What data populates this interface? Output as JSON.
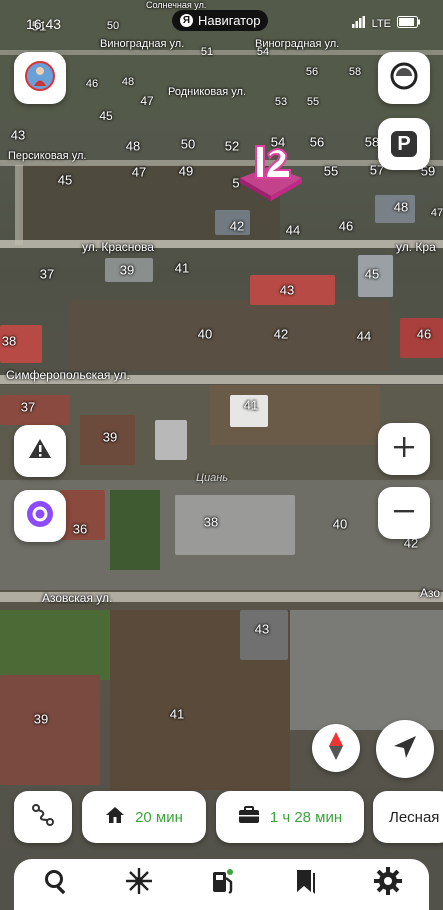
{
  "status_bar": {
    "time": "16:43",
    "app_name": "Навигатор",
    "network": "LTE"
  },
  "map": {
    "streets": {
      "top_street": "Солнечная ул.",
      "vinogradnaya_left": "Виноградная ул.",
      "vinogradnaya_right": "Виноградная ул.",
      "rodnikovaya": "Родниковая ул.",
      "persikovaya": "Персиковая ул.",
      "krasnova_left": "ул. Краснова",
      "krasnova_right": "ул. Кра",
      "simferopolskaya": "Симферопольская ул.",
      "azovskaya_left": "Азовская ул.",
      "azovskaya_right": "Азо"
    },
    "house_numbers": [
      {
        "label": "51"
      },
      {
        "label": "50"
      },
      {
        "label": "49"
      },
      {
        "label": "48"
      },
      {
        "label": "51"
      },
      {
        "label": "54"
      },
      {
        "label": "56"
      },
      {
        "label": "58"
      },
      {
        "label": "46"
      },
      {
        "label": "48"
      },
      {
        "label": "47"
      },
      {
        "label": "53"
      },
      {
        "label": "55"
      },
      {
        "label": "45"
      },
      {
        "label": "48"
      },
      {
        "label": "50"
      },
      {
        "label": "52"
      },
      {
        "label": "54"
      },
      {
        "label": "56"
      },
      {
        "label": "58"
      },
      {
        "label": "43"
      },
      {
        "label": "45"
      },
      {
        "label": "47"
      },
      {
        "label": "49"
      },
      {
        "label": "5"
      },
      {
        "label": "55"
      },
      {
        "label": "57"
      },
      {
        "label": "59"
      },
      {
        "label": "48"
      },
      {
        "label": "42"
      },
      {
        "label": "44"
      },
      {
        "label": "46"
      },
      {
        "label": "37"
      },
      {
        "label": "39"
      },
      {
        "label": "41"
      },
      {
        "label": "43"
      },
      {
        "label": "45"
      },
      {
        "label": "47"
      },
      {
        "label": "38"
      },
      {
        "label": "40"
      },
      {
        "label": "42"
      },
      {
        "label": "44"
      },
      {
        "label": "46"
      },
      {
        "label": "37"
      },
      {
        "label": "39"
      },
      {
        "label": "41"
      },
      {
        "label": "36"
      },
      {
        "label": "38"
      },
      {
        "label": "40"
      },
      {
        "label": "42"
      },
      {
        "label": "43"
      },
      {
        "label": "39"
      },
      {
        "label": "41"
      }
    ],
    "watermark": "Циань"
  },
  "route_chips": {
    "home_time": "20 мин",
    "work_time": "1 ч 28 мин",
    "extra_place": "Лесная"
  },
  "icons": {
    "profile": "profile-avatar-icon",
    "layers": "layers-icon",
    "parking": "parking-icon",
    "parking_letter": "P",
    "alert": "road-event-icon",
    "alice": "alice-voice-icon",
    "zoom_in": "plus-icon",
    "zoom_out": "minus-icon",
    "compass": "compass-icon",
    "locate": "my-location-arrow-icon",
    "routes": "route-icon",
    "home": "home-icon",
    "work": "briefcase-icon",
    "search": "search-icon",
    "discovery": "sparkle-icon",
    "fuel": "fuel-icon",
    "bookmarks": "bookmark-icon",
    "settings": "gear-icon"
  },
  "colors": {
    "accent_green": "#3aa63a",
    "roof_red": "#b84a45",
    "alice_purple": "#8c4bff",
    "marker_pink": "#e040a0"
  }
}
